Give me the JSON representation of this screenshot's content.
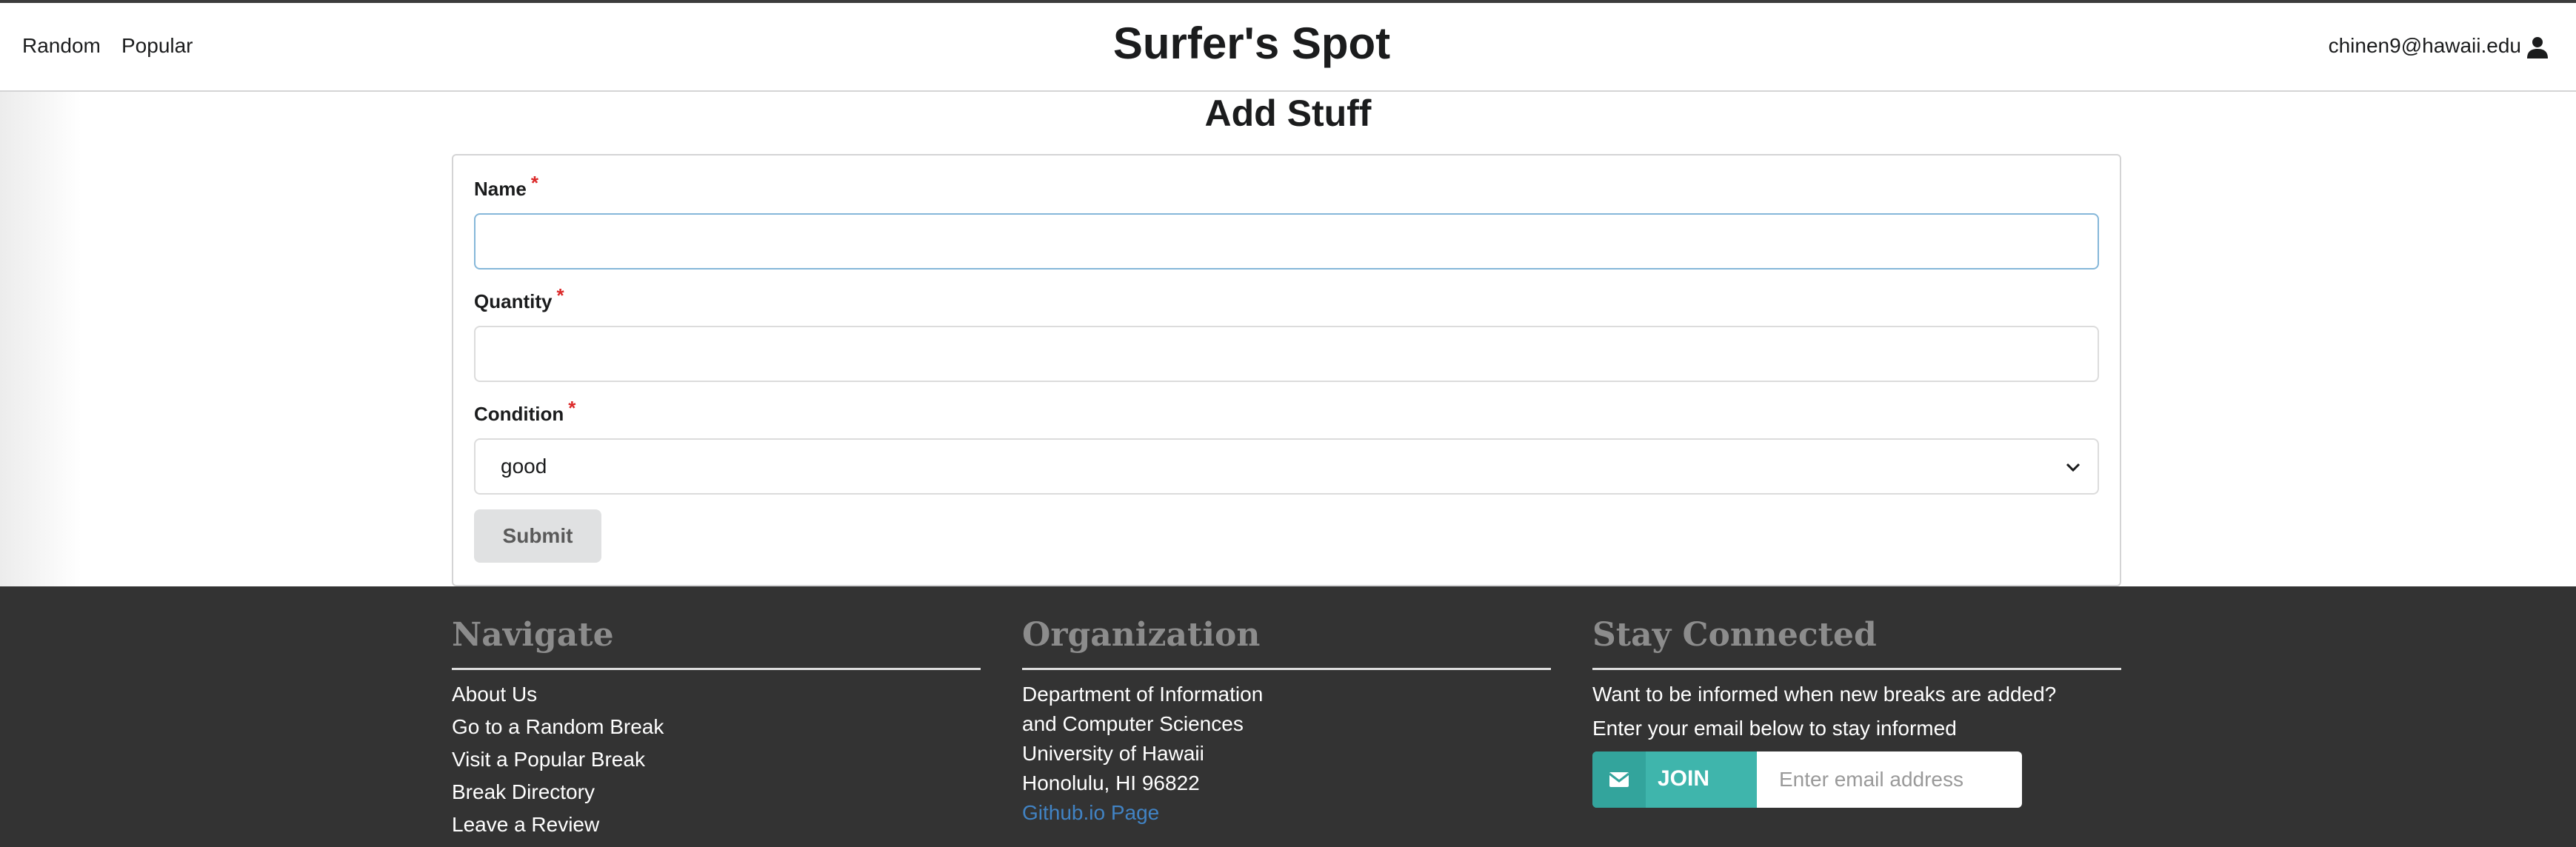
{
  "nav": {
    "links": [
      "Random",
      "Popular"
    ],
    "site_title": "Surfer's Spot",
    "user_email": "chinen9@hawaii.edu"
  },
  "page": {
    "heading": "Add Stuff"
  },
  "form": {
    "fields": [
      {
        "label": "Name",
        "required_mark": "*",
        "value": "",
        "focused": true
      },
      {
        "label": "Quantity",
        "required_mark": "*",
        "value": ""
      },
      {
        "label": "Condition",
        "required_mark": "*",
        "selected": "good"
      }
    ],
    "submit_label": "Submit"
  },
  "footer": {
    "navigate": {
      "heading": "Navigate",
      "links": [
        "About Us",
        "Go to a Random Break",
        "Visit a Popular Break",
        "Break Directory",
        "Leave a Review"
      ]
    },
    "organization": {
      "heading": "Organization",
      "lines": [
        "Department of Information",
        "and Computer Sciences",
        "University of Hawaii",
        "Honolulu, HI 96822"
      ],
      "link": "Github.io Page"
    },
    "stay_connected": {
      "heading": "Stay Connected",
      "lines": [
        "Want to be informed when new breaks are added?",
        "Enter your email below to stay informed"
      ],
      "join_label": "JOIN",
      "email_placeholder": "Enter email address"
    }
  },
  "colors": {
    "footer_bg": "#333333",
    "join_teal": "#3fb5ac",
    "required_red": "#db2828",
    "link_blue": "#4183c4"
  },
  "icons": [
    "user-icon",
    "chevron-down-icon",
    "envelope-icon"
  ]
}
